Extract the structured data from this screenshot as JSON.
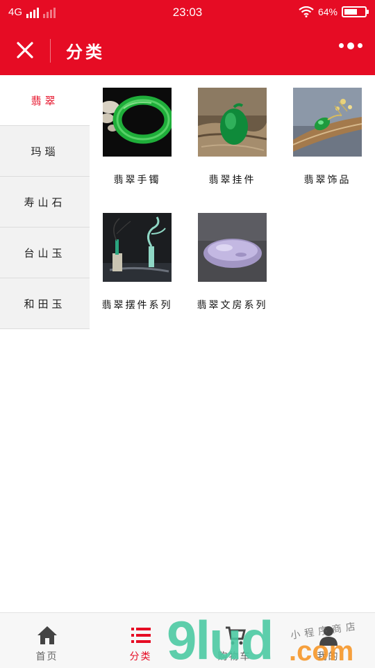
{
  "status_bar": {
    "network": "4G",
    "time": "23:03",
    "battery_percent": "64%",
    "battery_level": 0.64
  },
  "title_bar": {
    "title": "分类",
    "close_icon": "close-icon",
    "more_icon": "more-dots-icon"
  },
  "sidebar": {
    "items": [
      {
        "label": "翡翠",
        "active": true
      },
      {
        "label": "玛瑙",
        "active": false
      },
      {
        "label": "寿山石",
        "active": false
      },
      {
        "label": "台山玉",
        "active": false
      },
      {
        "label": "和田玉",
        "active": false
      }
    ]
  },
  "products": [
    {
      "label": "翡翠手镯",
      "image": "green-jade-bangle"
    },
    {
      "label": "翡翠挂件",
      "image": "jade-pendant-on-wood"
    },
    {
      "label": "翡翠饰品",
      "image": "jade-brooch-on-branch"
    },
    {
      "label": "翡翠摆件系列",
      "image": "jade-figurine-ornament"
    },
    {
      "label": "翡翠文房系列",
      "image": "lavender-jade-stone"
    }
  ],
  "tabbar": {
    "items": [
      {
        "label": "首页",
        "icon": "home-icon",
        "active": false
      },
      {
        "label": "分类",
        "icon": "list-icon",
        "active": true
      },
      {
        "label": "购物车",
        "icon": "cart-icon",
        "active": false
      },
      {
        "label": "我的",
        "icon": "user-icon",
        "active": false
      }
    ]
  },
  "watermark": {
    "brand": "9lud",
    "domain": ".com",
    "tagline": "小程序商店"
  },
  "colors": {
    "brand_red": "#e60c24",
    "sidebar_bg": "#f2f2f2"
  }
}
